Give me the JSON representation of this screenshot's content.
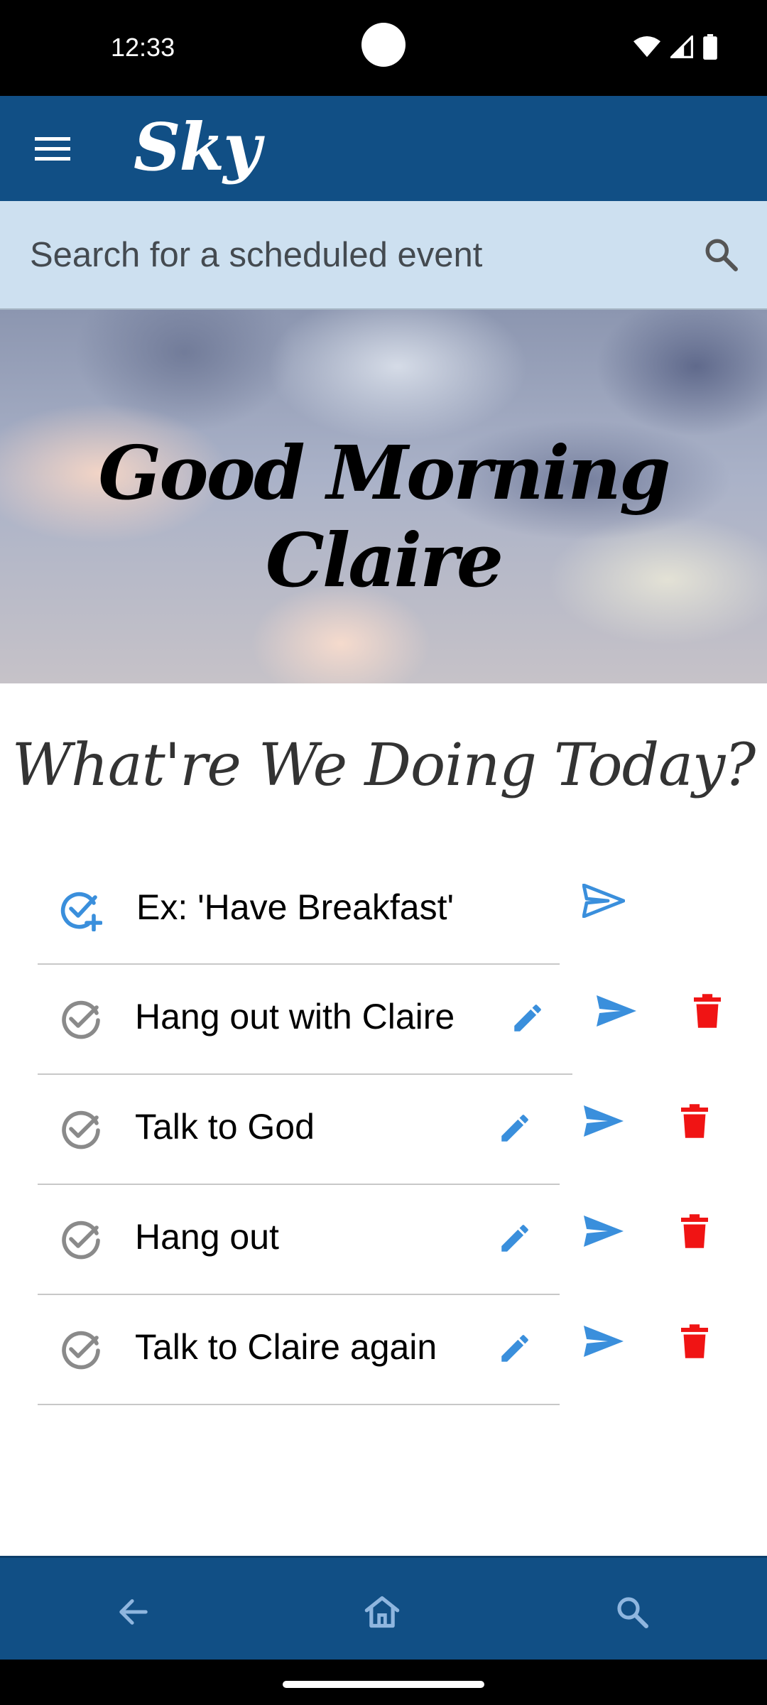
{
  "status_bar": {
    "time": "12:33"
  },
  "app_bar": {
    "brand": "Sky"
  },
  "search": {
    "placeholder": "Search for a scheduled event"
  },
  "hero": {
    "greeting": "Good Morning Claire"
  },
  "main": {
    "section_title": "What're We Doing Today?",
    "new_task_placeholder": "Ex: 'Have Breakfast'",
    "tasks": [
      {
        "label": "Hang out with Claire"
      },
      {
        "label": "Talk to God"
      },
      {
        "label": "Hang out"
      },
      {
        "label": "Talk to Claire again"
      }
    ]
  },
  "bottom_nav": {
    "items": [
      "back",
      "home",
      "search"
    ]
  },
  "colors": {
    "primary": "#114f85",
    "search_bg": "#cde0f0",
    "accent_blue": "#3a8fdc",
    "delete_red": "#f01414",
    "check_gray": "#8a8a8a"
  }
}
